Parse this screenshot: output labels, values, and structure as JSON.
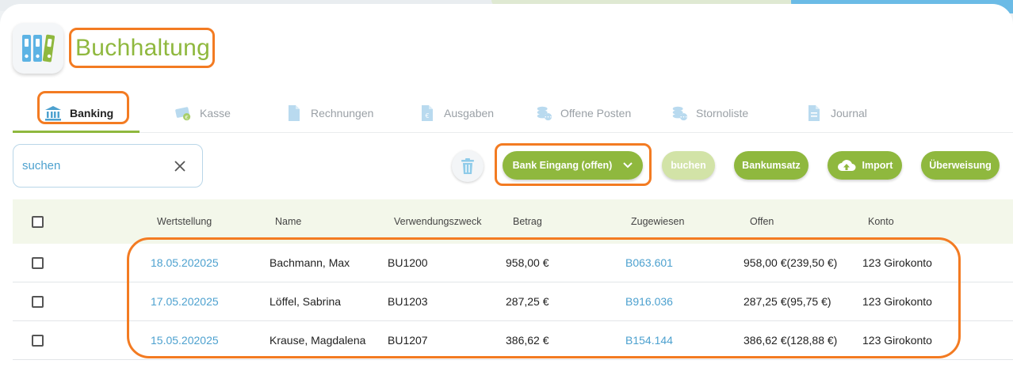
{
  "app": {
    "title": "Buchhaltung",
    "icon": "binders-icon"
  },
  "tabs": [
    {
      "label": "Banking",
      "icon": "bank-icon",
      "active": true
    },
    {
      "label": "Kasse",
      "icon": "cash-icon"
    },
    {
      "label": "Rechnungen",
      "icon": "document-icon"
    },
    {
      "label": "Ausgaben",
      "icon": "expense-document-icon"
    },
    {
      "label": "Offene Posten",
      "icon": "coins-icon"
    },
    {
      "label": "Stornoliste",
      "icon": "coins-icon"
    },
    {
      "label": "Journal",
      "icon": "journal-icon"
    }
  ],
  "search": {
    "placeholder": "suchen",
    "value": ""
  },
  "toolbar": {
    "filter_label": "Bank Eingang (offen)",
    "buchen_label": "buchen",
    "bankumsatz_label": "Bankumsatz",
    "import_label": "Import",
    "ueberweisung_label": "Überweisung"
  },
  "table": {
    "headers": {
      "wertstellung": "Wertstellung",
      "name": "Name",
      "verwendungszweck": "Verwendungszweck",
      "betrag": "Betrag",
      "zugewiesen": "Zugewiesen",
      "offen": "Offen",
      "konto": "Konto"
    },
    "rows": [
      {
        "wertstellung": "18.05.202025",
        "name": "Bachmann, Max",
        "verwendungszweck": "BU1200",
        "betrag": "958,00 €",
        "zugewiesen": "B063.601",
        "offen": "958,00 €(239,50 €)",
        "konto": "123 Girokonto"
      },
      {
        "wertstellung": "17.05.202025",
        "name": "Löffel, Sabrina",
        "verwendungszweck": "BU1203",
        "betrag": "287,25 €",
        "zugewiesen": "B916.036",
        "offen": "287,25 €(95,75 €)",
        "konto": "123 Girokonto"
      },
      {
        "wertstellung": "15.05.202025",
        "name": "Krause, Magdalena",
        "verwendungszweck": "BU1207",
        "betrag": "386,62 €",
        "zugewiesen": "B154.144",
        "offen": "386,62 €(128,88 €)",
        "konto": "123 Girokonto"
      }
    ]
  },
  "colors": {
    "accent_green": "#8fb83e",
    "link_blue": "#4da1cf",
    "annotation_orange": "#f37b22"
  }
}
